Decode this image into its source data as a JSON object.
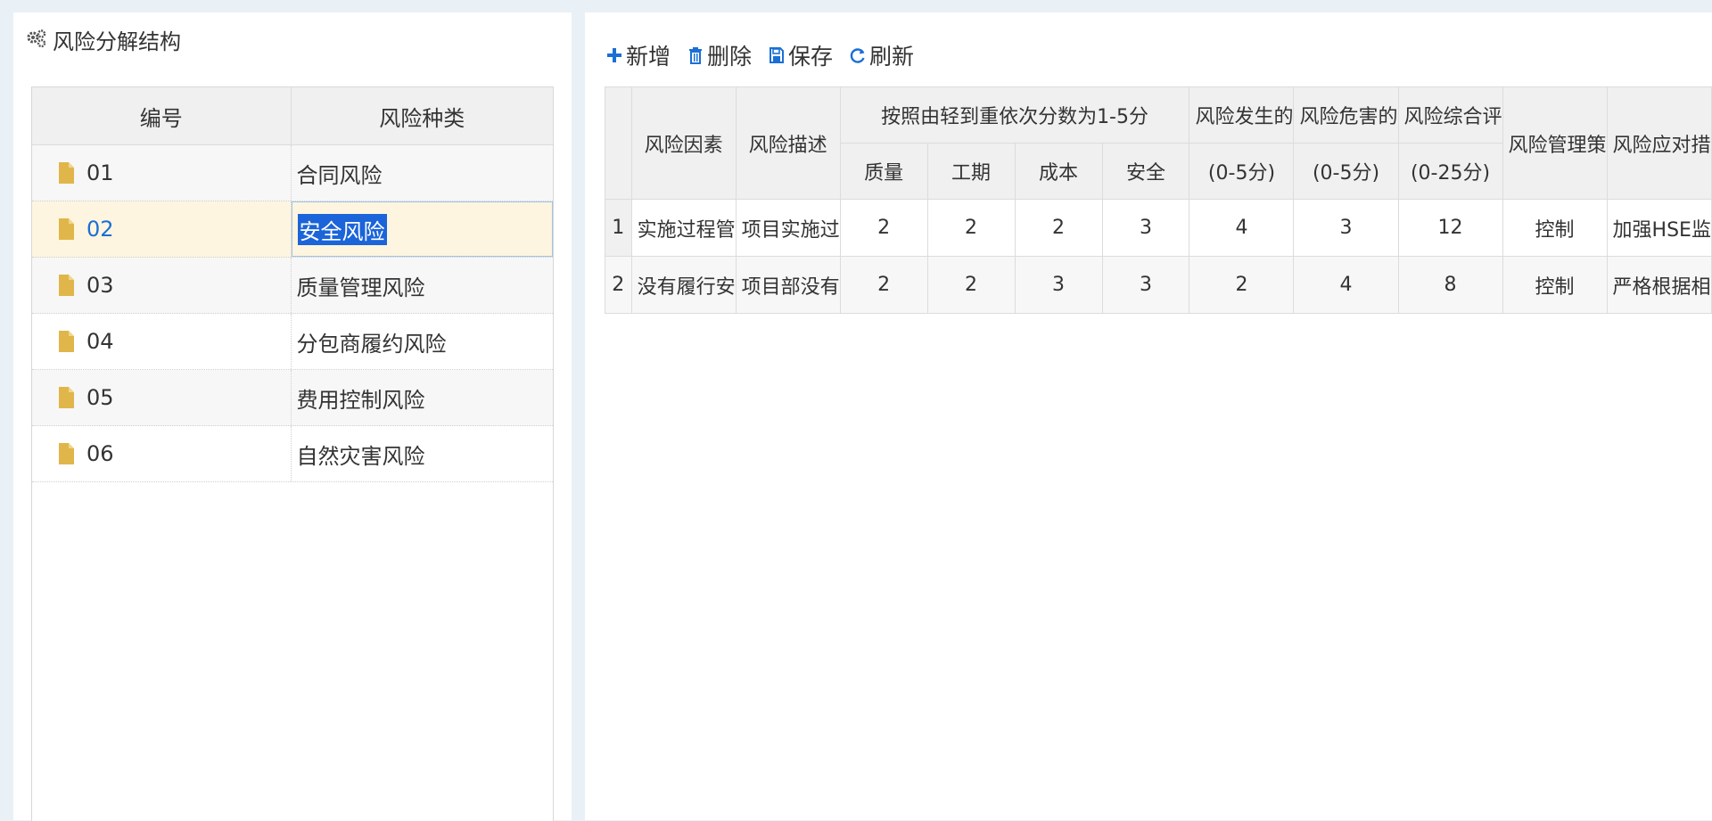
{
  "left_panel": {
    "title": "风险分解结构",
    "columns": [
      "编号",
      "风险种类"
    ],
    "rows": [
      {
        "code": "01",
        "name": "合同风险"
      },
      {
        "code": "02",
        "name": "安全风险"
      },
      {
        "code": "03",
        "name": "质量管理风险"
      },
      {
        "code": "04",
        "name": "分包商履约风险"
      },
      {
        "code": "05",
        "name": "费用控制风险"
      },
      {
        "code": "06",
        "name": "自然灾害风险"
      }
    ],
    "selected_index": 1
  },
  "toolbar": {
    "add": "新增",
    "delete": "删除",
    "save": "保存",
    "refresh": "刷新"
  },
  "grid": {
    "headers": {
      "factor": "风险因素",
      "description": "风险描述",
      "score_group": "按照由轻到重依次分数为1-5分",
      "quality": "质量",
      "schedule": "工期",
      "cost": "成本",
      "safety": "安全",
      "occurrence": "风险发生的",
      "occurrence_range": "(0-5分)",
      "hazard": "风险危害的",
      "hazard_range": "(0-5分)",
      "overall": "风险综合评",
      "overall_range": "(0-25分)",
      "strategy": "风险管理策",
      "response": "风险应对措"
    },
    "rows": [
      {
        "num": "1",
        "factor": "实施过程管",
        "description": "项目实施过",
        "quality": "2",
        "schedule": "2",
        "cost": "2",
        "safety": "3",
        "occurrence": "4",
        "hazard": "3",
        "overall": "12",
        "strategy": "控制",
        "response": "加强HSE监"
      },
      {
        "num": "2",
        "factor": "没有履行安",
        "description": "项目部没有",
        "quality": "2",
        "schedule": "2",
        "cost": "3",
        "safety": "3",
        "occurrence": "2",
        "hazard": "4",
        "overall": "8",
        "strategy": "控制",
        "response": "严格根据相"
      }
    ]
  },
  "colors": {
    "accent": "#1a6fd6",
    "folder": "#e0b64a",
    "selected_row": "#fdf5df",
    "background": "#e9f1f7"
  }
}
